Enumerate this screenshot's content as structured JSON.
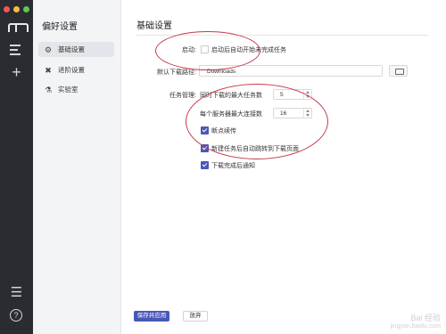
{
  "window": {
    "traffic_colors": [
      "#ee5a53",
      "#f5bd3d",
      "#5cc94b"
    ],
    "rail_icons": [
      "logo-icon",
      "menu-icon",
      "plus-icon",
      "sliders-icon",
      "help-icon"
    ]
  },
  "sidebar": {
    "title": "偏好设置",
    "items": [
      {
        "label": "基础设置",
        "icon": "gear-icon",
        "active": true
      },
      {
        "label": "进阶设置",
        "icon": "wrench-icon",
        "active": false
      },
      {
        "label": "实验室",
        "icon": "beaker-icon",
        "active": false
      }
    ]
  },
  "main": {
    "title": "基础设置",
    "startup": {
      "label": "启动:",
      "option": "启动后自动开始未完成任务",
      "checked": false
    },
    "download_path": {
      "label": "默认下载路径:",
      "value": "Downloads"
    },
    "task_manage": {
      "label": "任务管理:",
      "max_tasks_label": "同时下载的最大任务数",
      "max_tasks_value": "5",
      "max_conn_label": "每个服务器最大连接数",
      "max_conn_value": "16",
      "options": [
        {
          "label": "断点续传",
          "checked": true
        },
        {
          "label": "新建任务后自动跳转到下载页面",
          "checked": true
        },
        {
          "label": "下载完成后通知",
          "checked": true
        }
      ]
    },
    "buttons": {
      "save": "保存并应用",
      "discard": "放弃"
    }
  },
  "watermark": {
    "line1": "Bai 经验",
    "line2": "jingyan.baidu.com"
  },
  "annotation_color": "#c9374a",
  "accent_color": "#4a57b8"
}
